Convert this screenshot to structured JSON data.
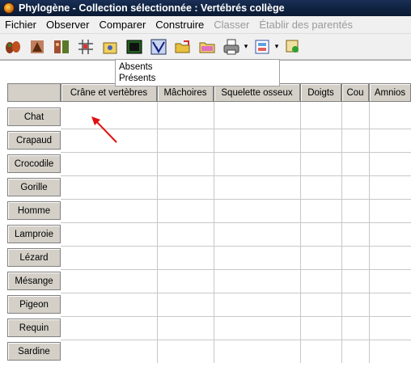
{
  "window": {
    "title": "Phylogène - Collection sélectionnée : Vertébrés collège",
    "icon": "phylogene-app-icon"
  },
  "menu": [
    {
      "label": "Fichier",
      "enabled": true
    },
    {
      "label": "Observer",
      "enabled": true
    },
    {
      "label": "Comparer",
      "enabled": true
    },
    {
      "label": "Construire",
      "enabled": true
    },
    {
      "label": "Classer",
      "enabled": false
    },
    {
      "label": "Établir des parentés",
      "enabled": false
    }
  ],
  "toolbar": {
    "buttons": [
      "organisms-icon",
      "observe-icon",
      "compare-icon",
      "matrix-icon",
      "notes-icon",
      "display-icon",
      "tree-icon",
      "open-folder-icon",
      "folder-icon",
      "print-icon",
      "export-icon",
      "tools-icon"
    ]
  },
  "grid": {
    "columns": [
      "Crâne et vertèbres",
      "Mâchoires",
      "Squelette osseux",
      "Doigts",
      "Cou",
      "Amnios"
    ],
    "rows": [
      "Chat",
      "Crapaud",
      "Crocodile",
      "Gorille",
      "Homme",
      "Lamproie",
      "Lézard",
      "Mésange",
      "Pigeon",
      "Requin",
      "Sardine"
    ]
  },
  "popup": {
    "options": [
      "Absents",
      "Présents"
    ]
  },
  "colors": {
    "titlebar": "#0f2240",
    "header_bg": "#d4d0c8",
    "arrow": "#e01010"
  }
}
